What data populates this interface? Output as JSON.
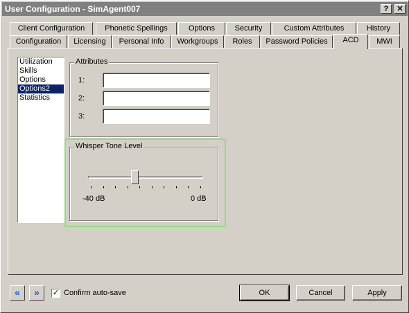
{
  "window": {
    "title": "User Configuration - SimAgent007",
    "help_glyph": "?",
    "close_glyph": "✕"
  },
  "tabs_back": [
    {
      "label": "Client Configuration"
    },
    {
      "label": "Phonetic Spellings"
    },
    {
      "label": "Options"
    },
    {
      "label": "Security"
    },
    {
      "label": "Custom Attributes"
    },
    {
      "label": "History"
    }
  ],
  "tabs_front": [
    {
      "label": "Configuration"
    },
    {
      "label": "Licensing"
    },
    {
      "label": "Personal Info"
    },
    {
      "label": "Workgroups"
    },
    {
      "label": "Roles"
    },
    {
      "label": "Password Policies"
    },
    {
      "label": "ACD",
      "active": true
    },
    {
      "label": "MWI"
    }
  ],
  "sidebar": {
    "items": [
      {
        "label": "Utilization"
      },
      {
        "label": "Skills"
      },
      {
        "label": "Options"
      },
      {
        "label": "Options2",
        "selected": true
      },
      {
        "label": "Statistics"
      }
    ]
  },
  "attributes": {
    "title": "Attributes",
    "fields": [
      {
        "label": "1:",
        "value": ""
      },
      {
        "label": "2:",
        "value": ""
      },
      {
        "label": "3:",
        "value": ""
      }
    ]
  },
  "whisper": {
    "title": "Whisper Tone Level",
    "min_label": "-40 dB",
    "max_label": "0 dB",
    "min_db": -40,
    "max_db": 0,
    "value_fraction": 0.4,
    "highlight_color": "#8ee07a"
  },
  "footer": {
    "back_icon": "«",
    "forward_icon": "»",
    "confirm_label": "Confirm auto-save",
    "confirm_checked": true,
    "check_glyph": "✓",
    "ok_label": "OK",
    "cancel_label": "Cancel",
    "apply_label": "Apply"
  }
}
